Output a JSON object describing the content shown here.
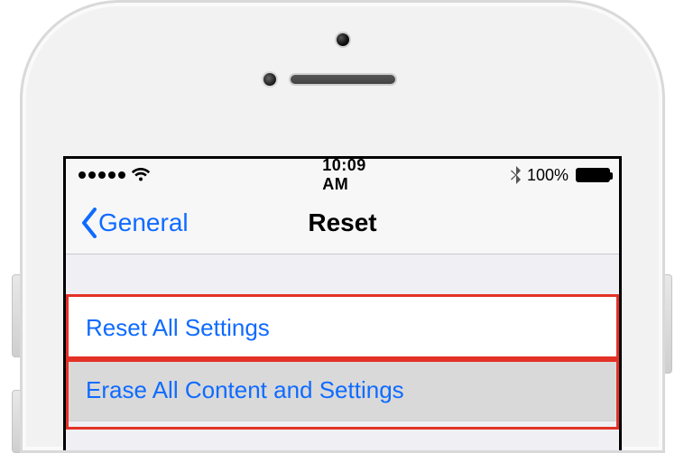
{
  "status": {
    "time": "10:09 AM",
    "battery_pct": "100%"
  },
  "nav": {
    "back_label": "General",
    "title": "Reset"
  },
  "rows": {
    "reset_all": "Reset All Settings",
    "erase_all": "Erase All Content and Settings"
  }
}
